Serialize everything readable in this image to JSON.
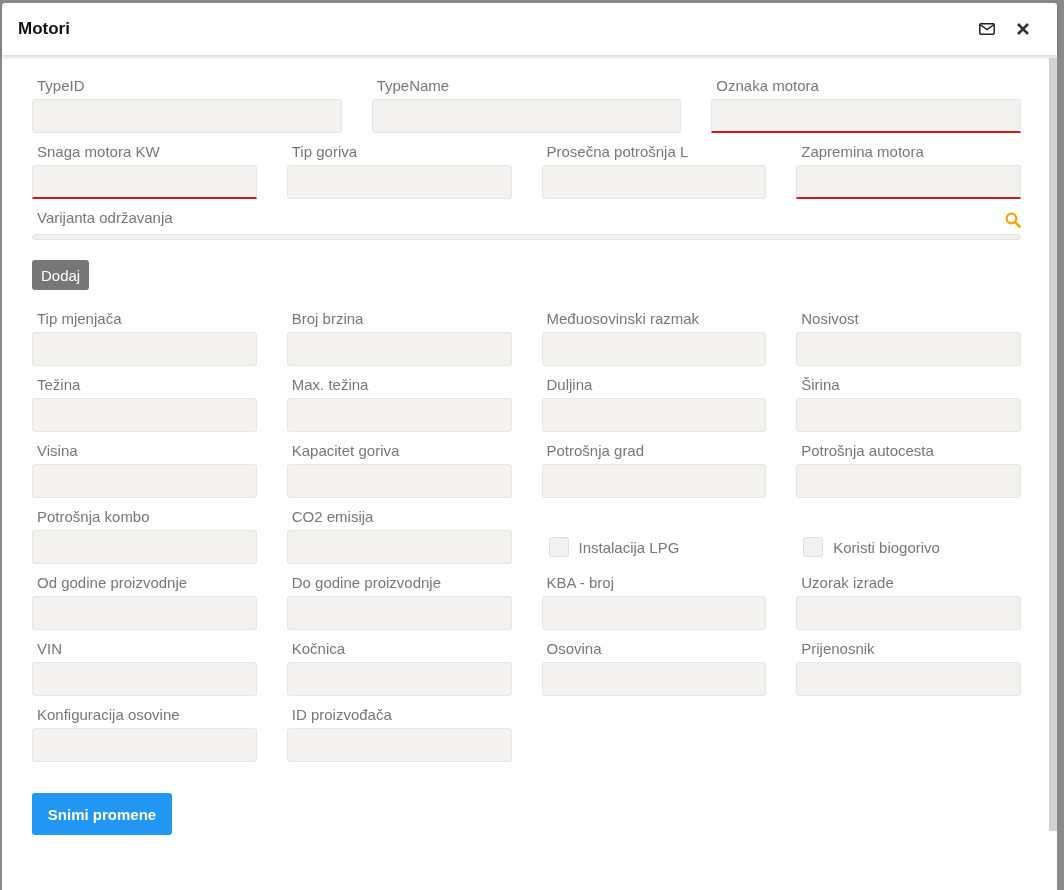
{
  "dialog": {
    "title": "Motori"
  },
  "rows": [
    {
      "fields": [
        {
          "kind": "text",
          "label": "TypeID",
          "required": false
        },
        {
          "kind": "text",
          "label": "TypeName",
          "required": false
        },
        {
          "kind": "text",
          "label": "Oznaka motora",
          "required": true
        }
      ]
    },
    {
      "fields": [
        {
          "kind": "text",
          "label": "Snaga motora KW",
          "required": true
        },
        {
          "kind": "text",
          "label": "Tip goriva",
          "required": false
        },
        {
          "kind": "text",
          "label": "Prosečna potrošnja L",
          "required": false
        },
        {
          "kind": "text",
          "label": "Zapremina motora",
          "required": true
        }
      ]
    },
    {
      "fields": [
        {
          "kind": "lookup",
          "label": "Varijanta održavanja"
        }
      ]
    }
  ],
  "add_button": "Dodaj",
  "grid": [
    {
      "kind": "text",
      "label": "Tip mjenjača"
    },
    {
      "kind": "text",
      "label": "Broj brzina"
    },
    {
      "kind": "text",
      "label": "Međuosovinski razmak"
    },
    {
      "kind": "text",
      "label": "Nosivost"
    },
    {
      "kind": "text",
      "label": "Težina"
    },
    {
      "kind": "text",
      "label": "Max. težina"
    },
    {
      "kind": "text",
      "label": "Duljina"
    },
    {
      "kind": "text",
      "label": "Širina"
    },
    {
      "kind": "text",
      "label": "Visina"
    },
    {
      "kind": "text",
      "label": "Kapacitet goriva"
    },
    {
      "kind": "text",
      "label": "Potrošnja grad"
    },
    {
      "kind": "text",
      "label": "Potrošnja autocesta"
    },
    {
      "kind": "text",
      "label": "Potrošnja kombo"
    },
    {
      "kind": "text",
      "label": "CO2 emisija"
    },
    {
      "kind": "checkbox",
      "label": "Instalacija LPG",
      "checked": false
    },
    {
      "kind": "checkbox",
      "label": "Koristi biogorivo",
      "checked": false
    },
    {
      "kind": "text",
      "label": "Od godine proizvodnje"
    },
    {
      "kind": "text",
      "label": "Do godine proizvodnje"
    },
    {
      "kind": "text",
      "label": "KBA - broj"
    },
    {
      "kind": "text",
      "label": "Uzorak izrade"
    },
    {
      "kind": "text",
      "label": "VIN"
    },
    {
      "kind": "text",
      "label": "Kočnica"
    },
    {
      "kind": "text",
      "label": "Osovina"
    },
    {
      "kind": "text",
      "label": "Prijenosnik"
    },
    {
      "kind": "text",
      "label": "Konfiguracija osovine"
    },
    {
      "kind": "text",
      "label": "ID proizvođača"
    }
  ],
  "save_button": "Snimi promene"
}
